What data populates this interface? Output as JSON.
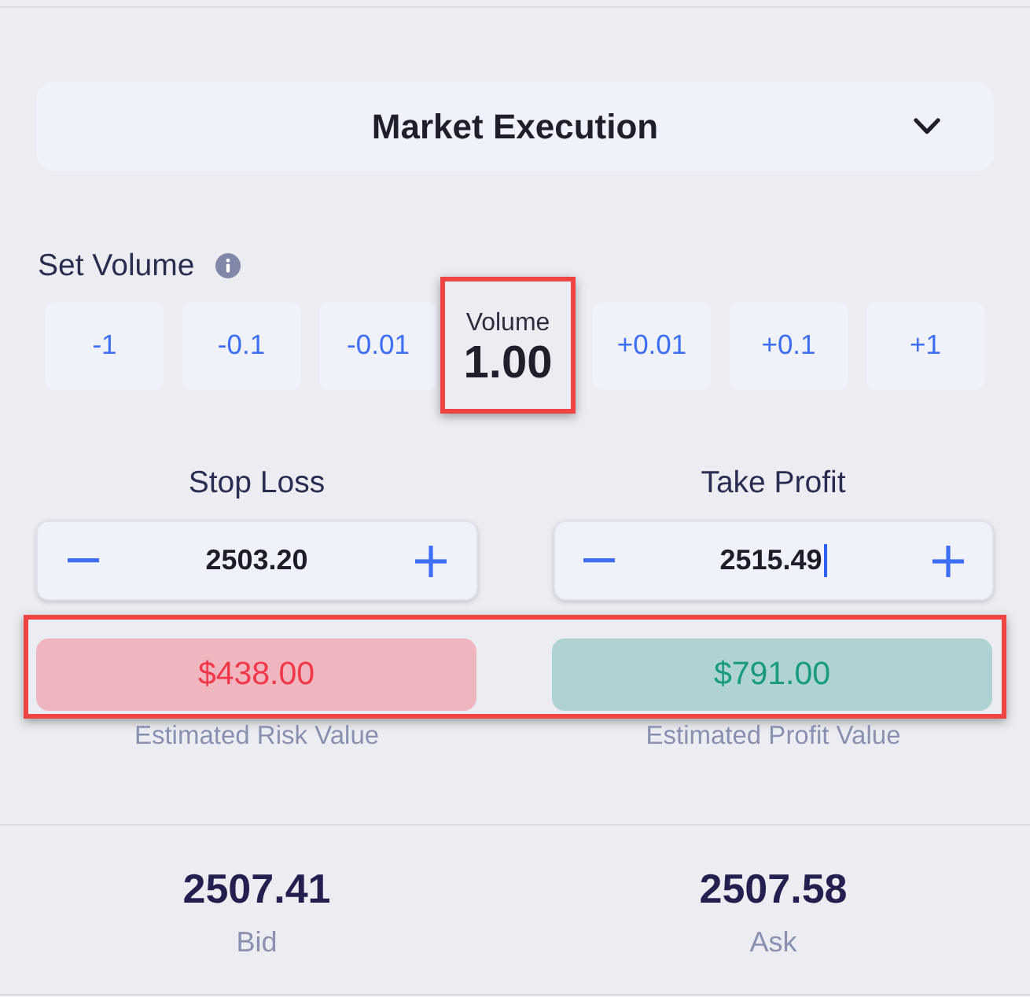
{
  "order_type": {
    "label": "Market Execution"
  },
  "volume": {
    "label": "Set Volume",
    "controls": [
      {
        "kind": "step",
        "label": "-1"
      },
      {
        "kind": "step",
        "label": "-0.1"
      },
      {
        "kind": "step",
        "label": "-0.01"
      },
      {
        "kind": "display",
        "label": "Volume",
        "value": "1.00",
        "highlighted": true
      },
      {
        "kind": "step",
        "label": "+0.01"
      },
      {
        "kind": "step",
        "label": "+0.1"
      },
      {
        "kind": "step",
        "label": "+1"
      }
    ]
  },
  "limits": {
    "fields": [
      {
        "label": "Stop Loss",
        "value": "2503.20",
        "focused": false
      },
      {
        "label": "Take Profit",
        "value": "2515.49",
        "focused": true
      }
    ],
    "estimates": {
      "highlighted": true,
      "items": [
        {
          "kind": "risk",
          "value": "$438.00",
          "caption": "Estimated Risk Value"
        },
        {
          "kind": "profit",
          "value": "$791.00",
          "caption": "Estimated Profit Value"
        }
      ]
    }
  },
  "quotes": [
    {
      "value": "2507.41",
      "label": "Bid"
    },
    {
      "value": "2507.58",
      "label": "Ask"
    }
  ]
}
